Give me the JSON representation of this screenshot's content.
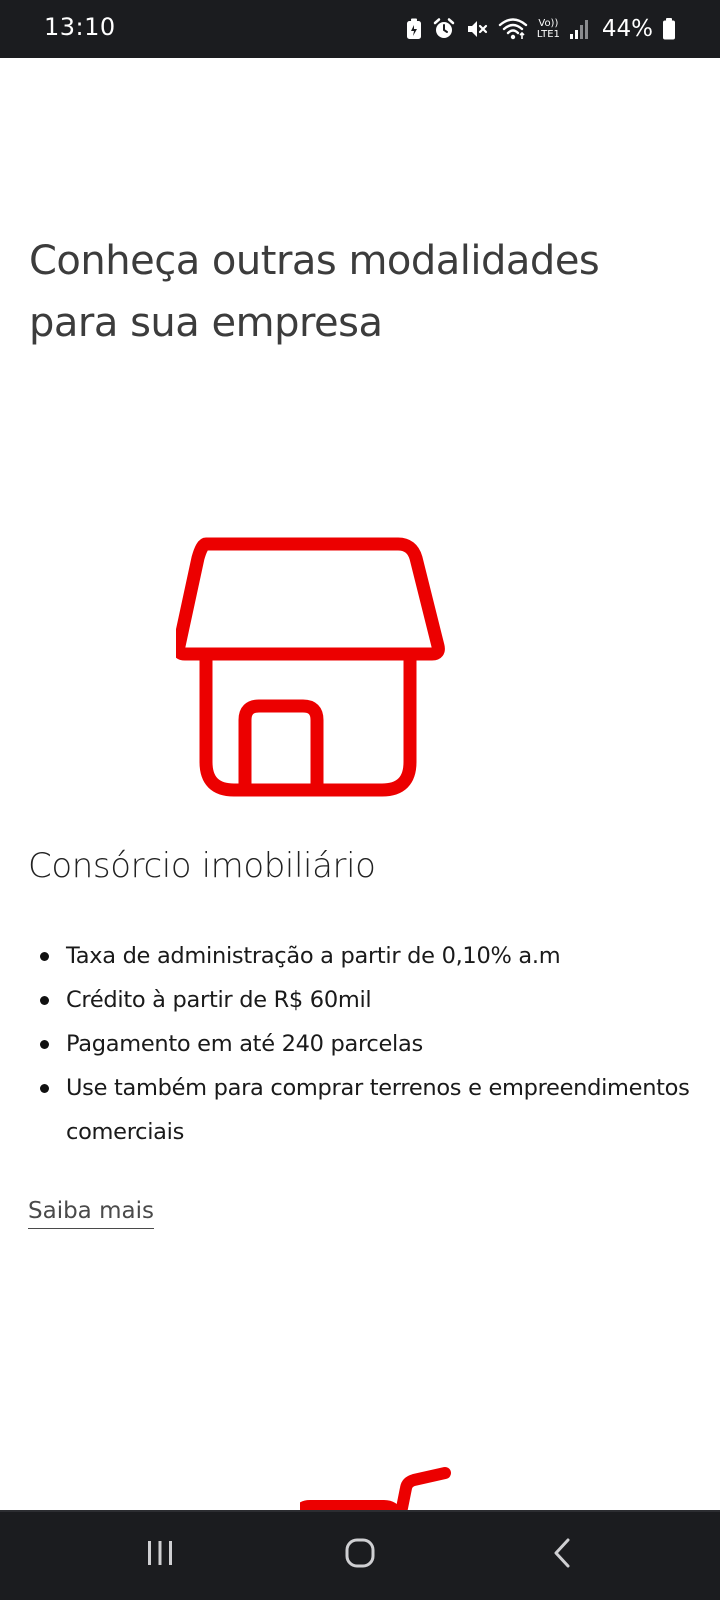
{
  "status_bar": {
    "time": "13:10",
    "network_label_top": "Vo))",
    "network_label_bottom": "LTE1",
    "battery": "44%",
    "icons": [
      "battery-saver-icon",
      "alarm-icon",
      "mute-icon",
      "wifi-icon",
      "signal-icon",
      "battery-icon"
    ]
  },
  "page": {
    "title": "Conheça outras modalidades para sua empresa"
  },
  "product": {
    "icon": "house-icon",
    "accent_color": "#ec0000",
    "title": "Consórcio imobiliário",
    "features": [
      "Taxa de administração a partir de 0,10% a.m",
      "Crédito à partir de R$ 60mil",
      "Pagamento em até 240 parcelas",
      "Use também para comprar terrenos e empreendimentos comerciais"
    ],
    "link_label": "Saiba mais"
  },
  "nav_bar": {
    "buttons": [
      "recent-apps-icon",
      "home-icon",
      "back-icon"
    ]
  }
}
